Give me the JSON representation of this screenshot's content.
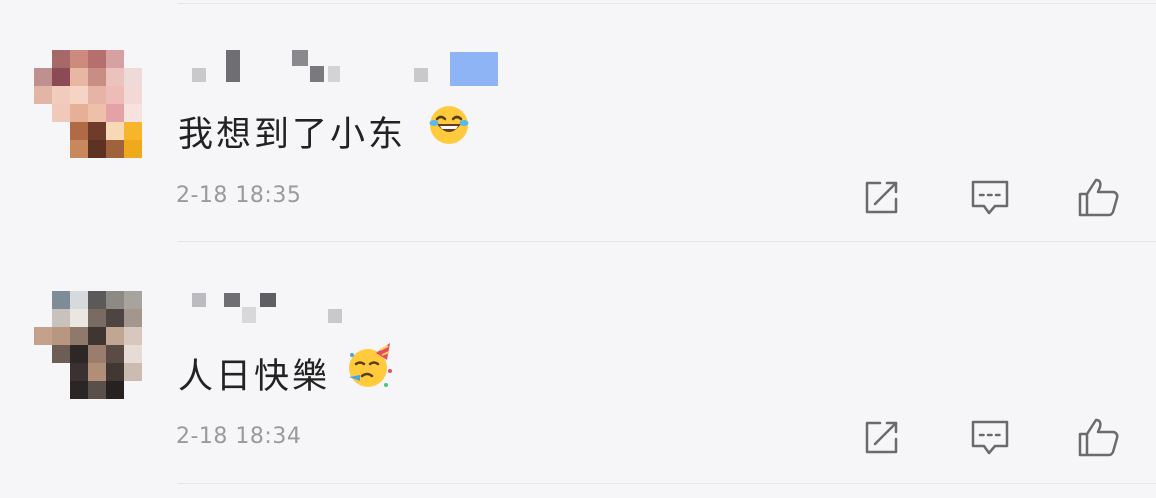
{
  "comments": [
    {
      "text": "我想到了小东",
      "emoji": "grinning-squinting-tears-emoji",
      "time": "2-18  18:35"
    },
    {
      "text": "人日快樂",
      "emoji": "partying-face-emoji",
      "time": "2-18  18:34"
    }
  ],
  "icons": {
    "share": "share-icon",
    "comment": "comment-icon",
    "like": "thumbs-up-icon"
  },
  "colors": {
    "background": "#f6f6f8",
    "text": "#222222",
    "timestamp": "#9a9a9a",
    "icon": "#6b6b6b",
    "divider": "#e6e6ea"
  }
}
